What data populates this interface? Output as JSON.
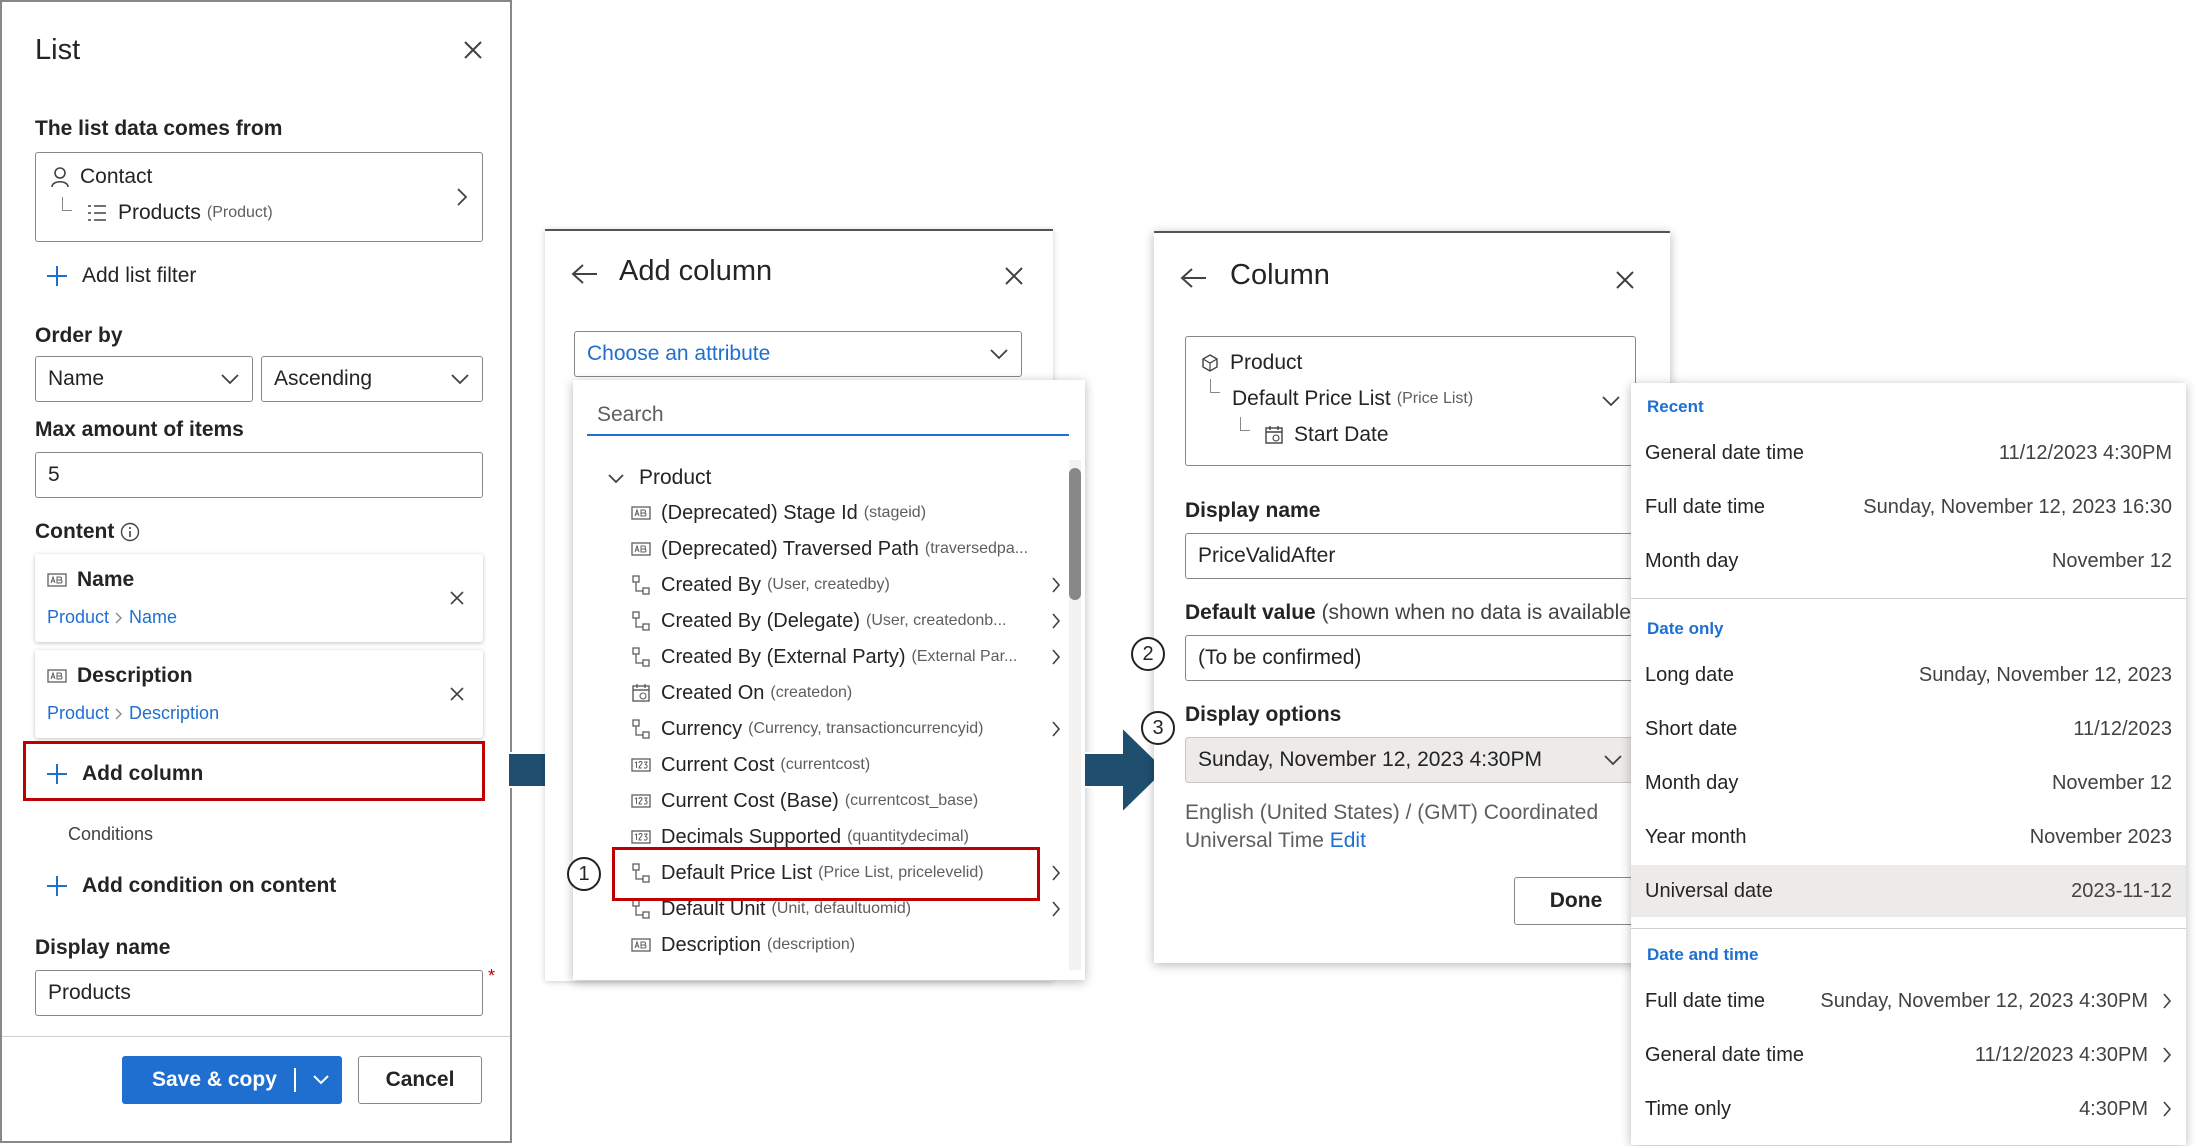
{
  "list_panel": {
    "title": "List",
    "source_label": "The list data comes from",
    "source_entity": "Contact",
    "source_relation": "Products",
    "source_relation_sub": "(Product)",
    "add_filter": "Add list filter",
    "order_by_label": "Order by",
    "order_field": "Name",
    "order_direction": "Ascending",
    "max_label": "Max amount of items",
    "max_value": "5",
    "content_label": "Content",
    "content_items": [
      {
        "name": "Name",
        "path_root": "Product",
        "path_leaf": "Name"
      },
      {
        "name": "Description",
        "path_root": "Product",
        "path_leaf": "Description"
      }
    ],
    "add_column": "Add column",
    "conditions_label": "Conditions",
    "add_condition": "Add condition on content",
    "display_name_label": "Display name",
    "display_name_value": "Products",
    "required_mark": "*",
    "save_button": "Save & copy",
    "cancel_button": "Cancel"
  },
  "add_column_panel": {
    "title": "Add column",
    "attribute_placeholder": "Choose an attribute",
    "search_placeholder": "Search",
    "group": "Product",
    "attributes": [
      {
        "label": "(Deprecated) Stage Id",
        "sub": "(stageid)",
        "icon": "text-field-icon",
        "expand": false
      },
      {
        "label": "(Deprecated) Traversed Path",
        "sub": "(traversedpa...",
        "icon": "text-field-icon",
        "expand": false
      },
      {
        "label": "Created By",
        "sub": "(User, createdby)",
        "icon": "relationship-icon",
        "expand": true
      },
      {
        "label": "Created By (Delegate)",
        "sub": "(User, createdonb...",
        "icon": "relationship-icon",
        "expand": true
      },
      {
        "label": "Created By (External Party)",
        "sub": "(External Par...",
        "icon": "relationship-icon",
        "expand": true
      },
      {
        "label": "Created On",
        "sub": "(createdon)",
        "icon": "calendar-icon",
        "expand": false
      },
      {
        "label": "Currency",
        "sub": "(Currency, transactioncurrencyid)",
        "icon": "relationship-icon",
        "expand": true
      },
      {
        "label": "Current Cost",
        "sub": "(currentcost)",
        "icon": "number-field-icon",
        "expand": false
      },
      {
        "label": "Current Cost (Base)",
        "sub": "(currentcost_base)",
        "icon": "number-field-icon",
        "expand": false
      },
      {
        "label": "Decimals Supported",
        "sub": "(quantitydecimal)",
        "icon": "number-field-icon",
        "expand": false
      },
      {
        "label": "Default Price List",
        "sub": "(Price List, pricelevelid)",
        "icon": "relationship-icon",
        "expand": true
      },
      {
        "label": "Default Unit",
        "sub": "(Unit, defaultuomid)",
        "icon": "relationship-icon",
        "expand": true
      },
      {
        "label": "Description",
        "sub": "(description)",
        "icon": "text-field-icon",
        "expand": false
      }
    ]
  },
  "column_panel": {
    "title": "Column",
    "path_root": "Product",
    "path_mid": "Default Price List",
    "path_mid_sub": "(Price List)",
    "path_leaf": "Start Date",
    "display_name_label": "Display name",
    "display_name_value": "PriceValidAfter",
    "default_label": "Default value",
    "default_hint": "(shown when no data is available)",
    "default_value": "(To be confirmed)",
    "options_label": "Display options",
    "options_value": "Sunday, November 12, 2023 4:30PM",
    "locale_text": "English (United States) / (GMT) Coordinated Universal Time",
    "edit_link": "Edit",
    "done_button": "Done"
  },
  "format_flyout": {
    "sections": [
      {
        "title": "Recent",
        "rows": [
          {
            "name": "General date time",
            "value": "11/12/2023 4:30PM",
            "chevron": false
          },
          {
            "name": "Full date time",
            "value": "Sunday, November 12, 2023 16:30",
            "chevron": false
          },
          {
            "name": "Month day",
            "value": "November 12",
            "chevron": false
          }
        ]
      },
      {
        "title": "Date only",
        "rows": [
          {
            "name": "Long date",
            "value": "Sunday, November 12, 2023",
            "chevron": false
          },
          {
            "name": "Short date",
            "value": "11/12/2023",
            "chevron": false
          },
          {
            "name": "Month day",
            "value": "November 12",
            "chevron": false
          },
          {
            "name": "Year month",
            "value": "November 2023",
            "chevron": false
          },
          {
            "name": "Universal date",
            "value": "2023-11-12",
            "chevron": false
          }
        ]
      },
      {
        "title": "Date and time",
        "rows": [
          {
            "name": "Full date time",
            "value": "Sunday, November 12, 2023 4:30PM",
            "chevron": true
          },
          {
            "name": "General date time",
            "value": "11/12/2023 4:30PM",
            "chevron": true
          },
          {
            "name": "Time only",
            "value": "4:30PM",
            "chevron": true
          }
        ]
      }
    ]
  },
  "steps": [
    "1",
    "2",
    "3"
  ],
  "colors": {
    "accent": "#1f6fd1",
    "highlight": "#c00000",
    "arrow": "#1f4e6f",
    "primary_button": "#1f6fd1"
  }
}
